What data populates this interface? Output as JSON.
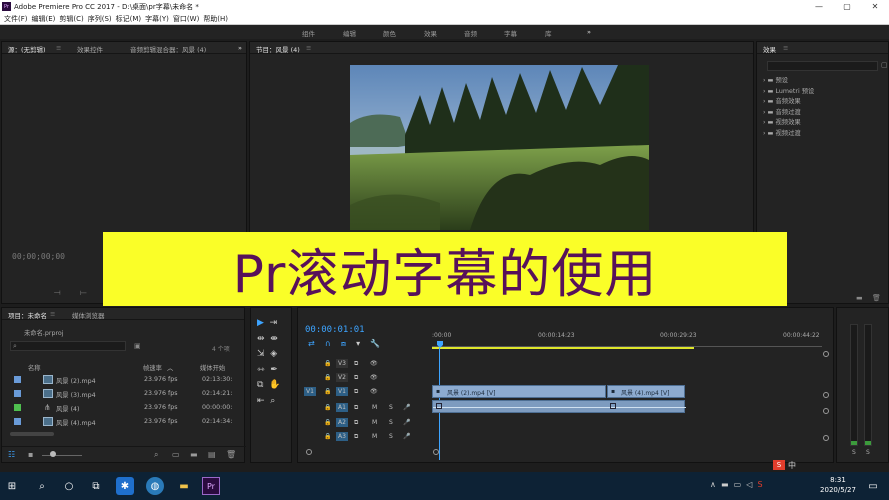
{
  "window": {
    "title": "Adobe Premiere Pro CC 2017 - D:\\桌面\\pr字幕\\未命名 *",
    "app_icon": "Pr",
    "controls": [
      "—",
      "▢",
      "✕"
    ]
  },
  "menu": [
    "文件(F)",
    "编辑(E)",
    "剪辑(C)",
    "序列(S)",
    "标记(M)",
    "字幕(Y)",
    "窗口(W)",
    "帮助(H)"
  ],
  "workspaces": [
    "组件",
    "编辑",
    "颜色",
    "效果",
    "音频",
    "字幕",
    "库",
    "»"
  ],
  "source_panel": {
    "tabs": [
      "源：(无剪辑)",
      "效果控件",
      "音频剪辑混合器：风景 (4)"
    ],
    "timecode": "00;00;00;00"
  },
  "program_panel": {
    "tab": "节目：风景 (4)"
  },
  "effects_panel": {
    "tab": "效果",
    "search_placeholder": "",
    "items": [
      "预设",
      "Lumetri 预设",
      "音频效果",
      "音频过渡",
      "视频效果",
      "视频过渡"
    ]
  },
  "banner": {
    "text": "Pr滚动字幕的使用",
    "background": "#fafe28",
    "color": "#57115a"
  },
  "project_panel": {
    "tabs": [
      "项目：未命名",
      "媒体浏览器"
    ],
    "file": "未命名.prproj",
    "count": "4 个项",
    "columns": {
      "name": "名称",
      "rate": "帧速率",
      "start": "媒体开始"
    },
    "rows": [
      {
        "name": "风景 (2).mp4",
        "rate": "23.976 fps",
        "start": "02:13:30:",
        "color": "#6a9bd8"
      },
      {
        "name": "风景 (3).mp4",
        "rate": "23.976 fps",
        "start": "02:14:21:",
        "color": "#6a9bd8"
      },
      {
        "name": "风景 (4)",
        "rate": "23.976 fps",
        "start": "00:00:00:",
        "color": "#4fbf4f"
      },
      {
        "name": "风景 (4).mp4",
        "rate": "23.976 fps",
        "start": "02:14:34:",
        "color": "#6a9bd8"
      }
    ]
  },
  "timeline": {
    "timecode": "00:00:01:01",
    "ruler": [
      ":00:00",
      "00:00:14:23",
      "00:00:29:23",
      "00:00:44:22"
    ],
    "tracks": {
      "video": [
        "V3",
        "V2",
        "V1"
      ],
      "audio": [
        "A1",
        "A2",
        "A3"
      ],
      "source_v": "V1",
      "m": "M",
      "s": "S"
    },
    "clips": [
      {
        "label": "风景 (2).mp4 [V]"
      },
      {
        "label": "风景 (4).mp4 [V]"
      }
    ]
  },
  "meters": {
    "labels": [
      "S",
      "S"
    ]
  },
  "taskbar": {
    "time": "8:31",
    "date": "2020/5/27",
    "ime": "中"
  }
}
